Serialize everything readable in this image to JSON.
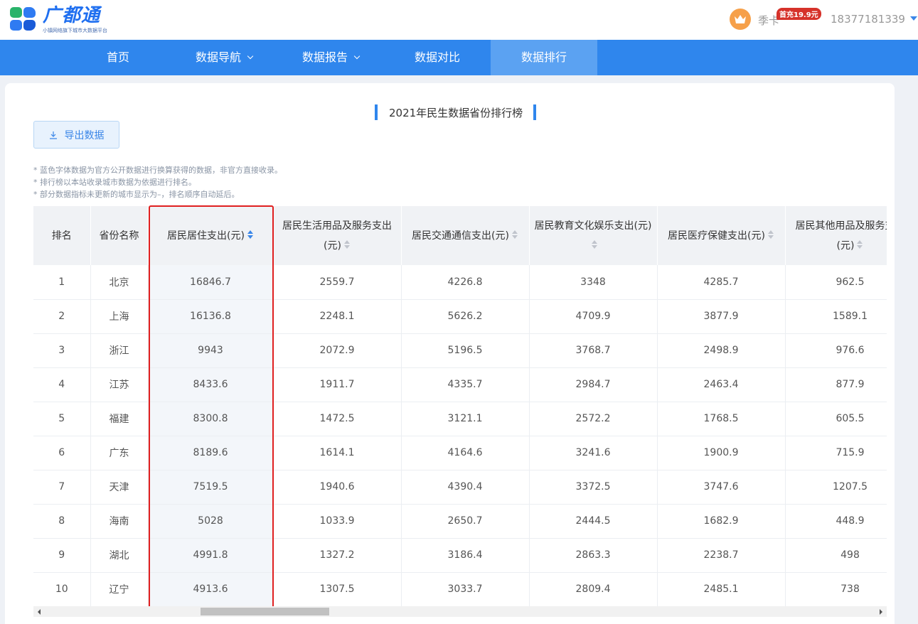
{
  "header": {
    "logo_name": "广都通",
    "logo_sub": "小镇网络旗下城市大数据平台",
    "vip_label": "季卡",
    "vip_badge": "首充19.9元",
    "phone": "18377181339"
  },
  "nav": {
    "items": [
      {
        "label": "首页"
      },
      {
        "label": "数据导航"
      },
      {
        "label": "数据报告"
      },
      {
        "label": "数据对比"
      },
      {
        "label": "数据排行"
      }
    ]
  },
  "page": {
    "title": "2021年民生数据省份排行榜",
    "export_label": "导出数据",
    "notes": [
      "* 蓝色字体数据为官方公开数据进行换算获得的数据，非官方直接收录。",
      "* 排行榜以本站收录城市数据为依据进行排名。",
      "* 部分数据指标未更新的城市显示为–，排名顺序自动延后。"
    ]
  },
  "table": {
    "columns": [
      {
        "label": "排名"
      },
      {
        "label": "省份名称"
      },
      {
        "label": "居民居住支出(元)"
      },
      {
        "label": "居民生活用品及服务支出(元)"
      },
      {
        "label": "居民交通通信支出(元)"
      },
      {
        "label": "居民教育文化娱乐支出(元)"
      },
      {
        "label": "居民医疗保健支出(元)"
      },
      {
        "label": "居民其他用品及服务支出(元)"
      }
    ],
    "rows": [
      [
        "1",
        "北京",
        "16846.7",
        "2559.7",
        "4226.8",
        "3348",
        "4285.7",
        "962.5"
      ],
      [
        "2",
        "上海",
        "16136.8",
        "2248.1",
        "5626.2",
        "4709.9",
        "3877.9",
        "1589.1"
      ],
      [
        "3",
        "浙江",
        "9943",
        "2072.9",
        "5196.5",
        "3768.7",
        "2498.9",
        "976.6"
      ],
      [
        "4",
        "江苏",
        "8433.6",
        "1911.7",
        "4335.7",
        "2984.7",
        "2463.4",
        "877.9"
      ],
      [
        "5",
        "福建",
        "8300.8",
        "1472.5",
        "3121.1",
        "2572.2",
        "1768.5",
        "605.5"
      ],
      [
        "6",
        "广东",
        "8189.6",
        "1614.1",
        "4164.6",
        "3241.6",
        "1900.9",
        "715.9"
      ],
      [
        "7",
        "天津",
        "7519.5",
        "1940.6",
        "4390.4",
        "3372.5",
        "3747.6",
        "1207.5"
      ],
      [
        "8",
        "海南",
        "5028",
        "1033.9",
        "2650.7",
        "2444.5",
        "1682.9",
        "448.9"
      ],
      [
        "9",
        "湖北",
        "4991.8",
        "1327.2",
        "3186.4",
        "2863.3",
        "2238.7",
        "498"
      ],
      [
        "10",
        "辽宁",
        "4913.6",
        "1307.5",
        "3033.7",
        "2809.4",
        "2485.1",
        "738"
      ]
    ]
  },
  "colors": {
    "nav_bg": "#2f86ed",
    "nav_active": "#5ba2f2",
    "accent": "#3a86e8",
    "highlight_border": "#e02020"
  }
}
